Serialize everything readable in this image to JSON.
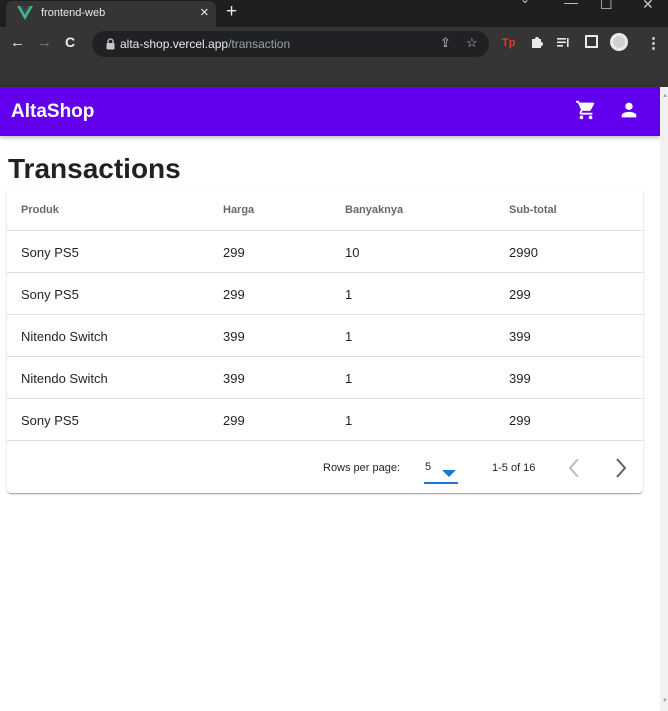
{
  "browser": {
    "tab_title": "frontend-web",
    "tab_close": "×",
    "new_tab": "+",
    "url_host": "alta-shop.vercel.app",
    "url_path": "/transaction",
    "controls": {
      "minimize": "—",
      "maximize": "☐",
      "close": "✕"
    },
    "nav": {
      "back": "←",
      "forward": "→",
      "reload": "C"
    }
  },
  "app": {
    "title": "AltaShop",
    "brand_color": "#6200ee"
  },
  "page": {
    "title": "Transactions"
  },
  "table": {
    "headers": [
      "Produk",
      "Harga",
      "Banyaknya",
      "Sub-total"
    ],
    "rows": [
      [
        "Sony PS5",
        "299",
        "10",
        "2990"
      ],
      [
        "Sony PS5",
        "299",
        "1",
        "299"
      ],
      [
        "Nitendo Switch",
        "399",
        "1",
        "399"
      ],
      [
        "Nitendo Switch",
        "399",
        "1",
        "399"
      ],
      [
        "Sony PS5",
        "299",
        "1",
        "299"
      ]
    ]
  },
  "pagination": {
    "rows_per_page_label": "Rows per page:",
    "rows_per_page_value": "5",
    "range_text": "1-5 of 16"
  }
}
